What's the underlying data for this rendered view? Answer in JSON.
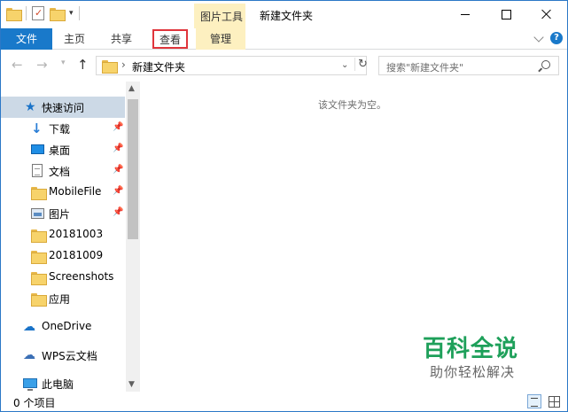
{
  "titlebar": {
    "contextual_group": "图片工具",
    "window_title": "新建文件夹"
  },
  "ribbon": {
    "tabs": [
      {
        "label": "文件",
        "state": "file"
      },
      {
        "label": "主页"
      },
      {
        "label": "共享"
      },
      {
        "label": "查看",
        "state": "highlighted"
      },
      {
        "label": "管理",
        "state": "contextual"
      }
    ],
    "colors": {
      "file_tab": "#1979ca",
      "contextual": "#fdf0c0",
      "highlight": "#e0353c"
    }
  },
  "address": {
    "path": "新建文件夹",
    "search_placeholder": "搜索\"新建文件夹\""
  },
  "navpane": {
    "items": [
      {
        "label": "快速访问",
        "icon": "star-icon",
        "selected": true
      },
      {
        "label": "下载",
        "icon": "download-icon",
        "pinned": true
      },
      {
        "label": "桌面",
        "icon": "desktop-icon",
        "pinned": true
      },
      {
        "label": "文档",
        "icon": "document-icon",
        "pinned": true
      },
      {
        "label": "MobileFile",
        "icon": "folder-icon",
        "pinned": true
      },
      {
        "label": "图片",
        "icon": "pictures-icon",
        "pinned": true
      },
      {
        "label": "20181003",
        "icon": "folder-icon"
      },
      {
        "label": "20181009",
        "icon": "folder-icon"
      },
      {
        "label": "Screenshots",
        "icon": "folder-icon"
      },
      {
        "label": "应用",
        "icon": "folder-icon"
      },
      {
        "label": "OneDrive",
        "icon": "onedrive-icon"
      },
      {
        "label": "WPS云文档",
        "icon": "wps-cloud-icon"
      },
      {
        "label": "此电脑",
        "icon": "this-pc-icon"
      }
    ]
  },
  "content": {
    "empty_message": "该文件夹为空。"
  },
  "watermark": {
    "main": "百科全说",
    "sub": "助你轻松解决"
  },
  "statusbar": {
    "item_count": "0 个项目"
  }
}
